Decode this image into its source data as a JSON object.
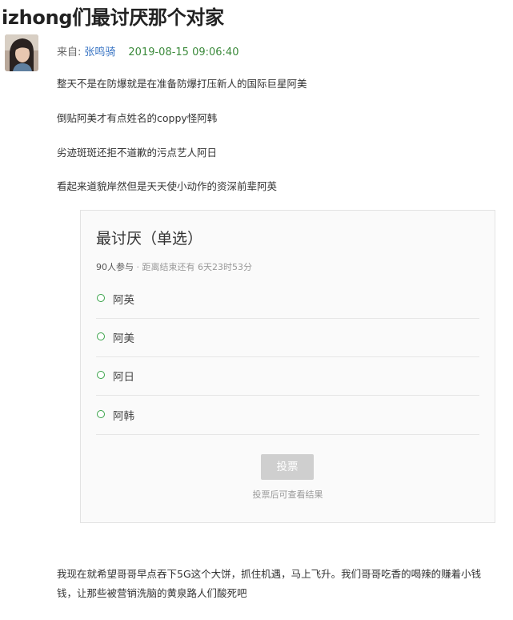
{
  "article": {
    "title": "izhong们最讨厌那个对家",
    "meta": {
      "from_label": "来自:",
      "author": "张鸣骑",
      "timestamp": "2019-08-15 09:06:40"
    },
    "paragraphs": [
      "整天不是在防爆就是在准备防爆打压新人的国际巨星阿美",
      "倒贴阿美才有点姓名的coppy怪阿韩",
      "劣迹斑斑还拒不道歉的污点艺人阿日",
      "看起来道貌岸然但是天天使小动作的资深前辈阿英"
    ],
    "closing": "我现在就希望哥哥早点吞下5G这个大饼，抓住机遇，马上飞升。我们哥哥吃香的喝辣的赚着小钱钱，让那些被营销洗脑的黄泉路人们酸死吧"
  },
  "poll": {
    "title": "最讨厌（单选）",
    "participants": "90人参与",
    "separator": " · ",
    "deadline": "距离结束还有 6天23时53分",
    "options": [
      "阿英",
      "阿美",
      "阿日",
      "阿韩"
    ],
    "vote_button": "投票",
    "hint": "投票后可查看结果"
  },
  "colors": {
    "author_link": "#3a75c4",
    "timestamp": "#3b8a3b",
    "radio_accent": "#3aa34a",
    "vote_button_disabled": "#cfcfcf"
  }
}
